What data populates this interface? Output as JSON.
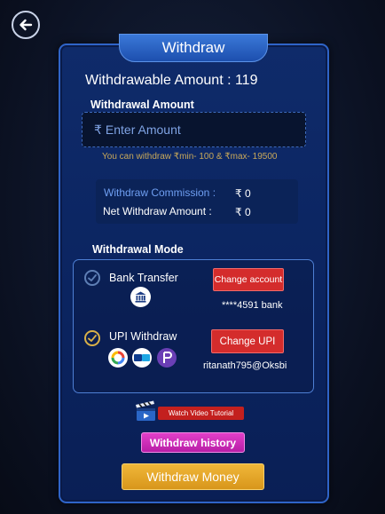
{
  "header": {
    "title": "Withdraw"
  },
  "balance": {
    "label": "Withdrawable Amount : 119"
  },
  "amount_section": {
    "label": "Withdrawal Amount",
    "currency_symbol": "₹",
    "placeholder": "Enter Amount",
    "value": "",
    "limits": "You can withdraw ₹min- 100 & ₹max- 19500"
  },
  "commission": {
    "commission_label": "Withdraw Commission :",
    "commission_value": "₹ 0",
    "net_label": "Net Withdraw Amount :",
    "net_value": "₹ 0"
  },
  "mode_section": {
    "label": "Withdrawal Mode",
    "options": [
      {
        "label": "Bank Transfer",
        "selected": false,
        "button": "Change account",
        "account": "****4591 bank",
        "icon": "bank-icon"
      },
      {
        "label": "UPI Withdraw",
        "selected": true,
        "button": "Change UPI",
        "account": "ritanath795@Oksbi",
        "icons": [
          "google-pay-icon",
          "paytm-icon",
          "phonepe-icon"
        ]
      }
    ]
  },
  "actions": {
    "video_tutorial": "Watch Video Tutorial",
    "history": "Withdraw history",
    "withdraw": "Withdraw Money"
  },
  "colors": {
    "panel": "#0b2460",
    "accent_blue": "#2f64c8",
    "red_button": "#d42c2c",
    "history_button": "#c92cb8",
    "withdraw_button": "#e2a52a",
    "limits_text": "#c8a85a",
    "selected_check": "#d8b048"
  }
}
